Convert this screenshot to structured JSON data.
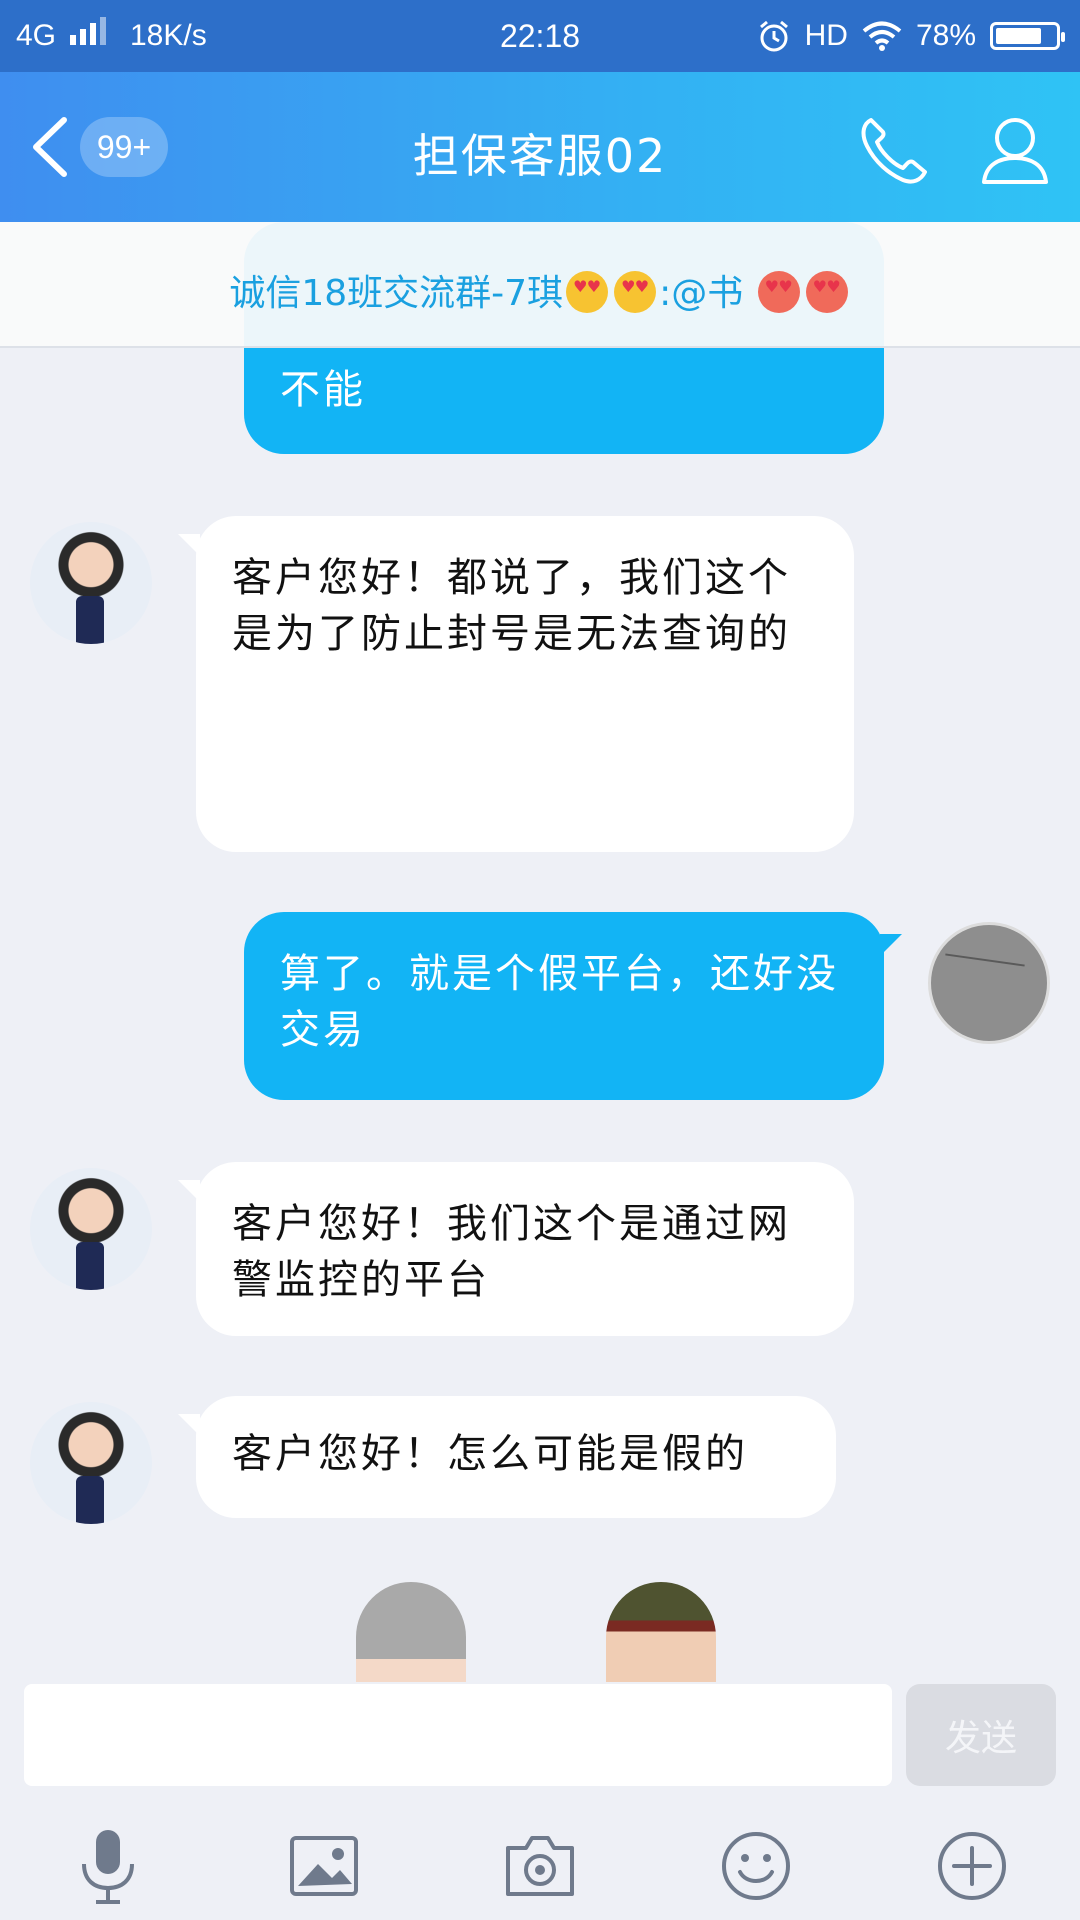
{
  "status_bar": {
    "network": "4G",
    "speed": "18K/s",
    "time": "22:18",
    "hd": "HD",
    "battery": "78%",
    "battery_level": 0.78
  },
  "header": {
    "unread_badge": "99+",
    "title": "担保客服02"
  },
  "notice": {
    "text_before": "诚信18班交流群-7琪",
    "text_after": ":@书"
  },
  "messages": [
    {
      "side": "out",
      "text": "不能"
    },
    {
      "side": "in",
      "text": "客户您好！都说了，我们这个是为了防止封号是无法查询的"
    },
    {
      "side": "out",
      "text": "算了。就是个假平台，还好没交易"
    },
    {
      "side": "in",
      "text": "客户您好！我们这个是通过网警监控的平台"
    },
    {
      "side": "in",
      "text": "客户您好！怎么可能是假的"
    }
  ],
  "composer": {
    "send_label": "发送",
    "placeholder": ""
  },
  "toolbar_icons": [
    "microphone-icon",
    "image-icon",
    "camera-icon",
    "emoji-icon",
    "plus-icon"
  ],
  "colors": {
    "header_start": "#3f8ef0",
    "header_end": "#2fc3f5",
    "outgoing_bubble": "#12b4f5",
    "incoming_bubble": "#ffffff",
    "notice_text": "#1aa0e0"
  }
}
